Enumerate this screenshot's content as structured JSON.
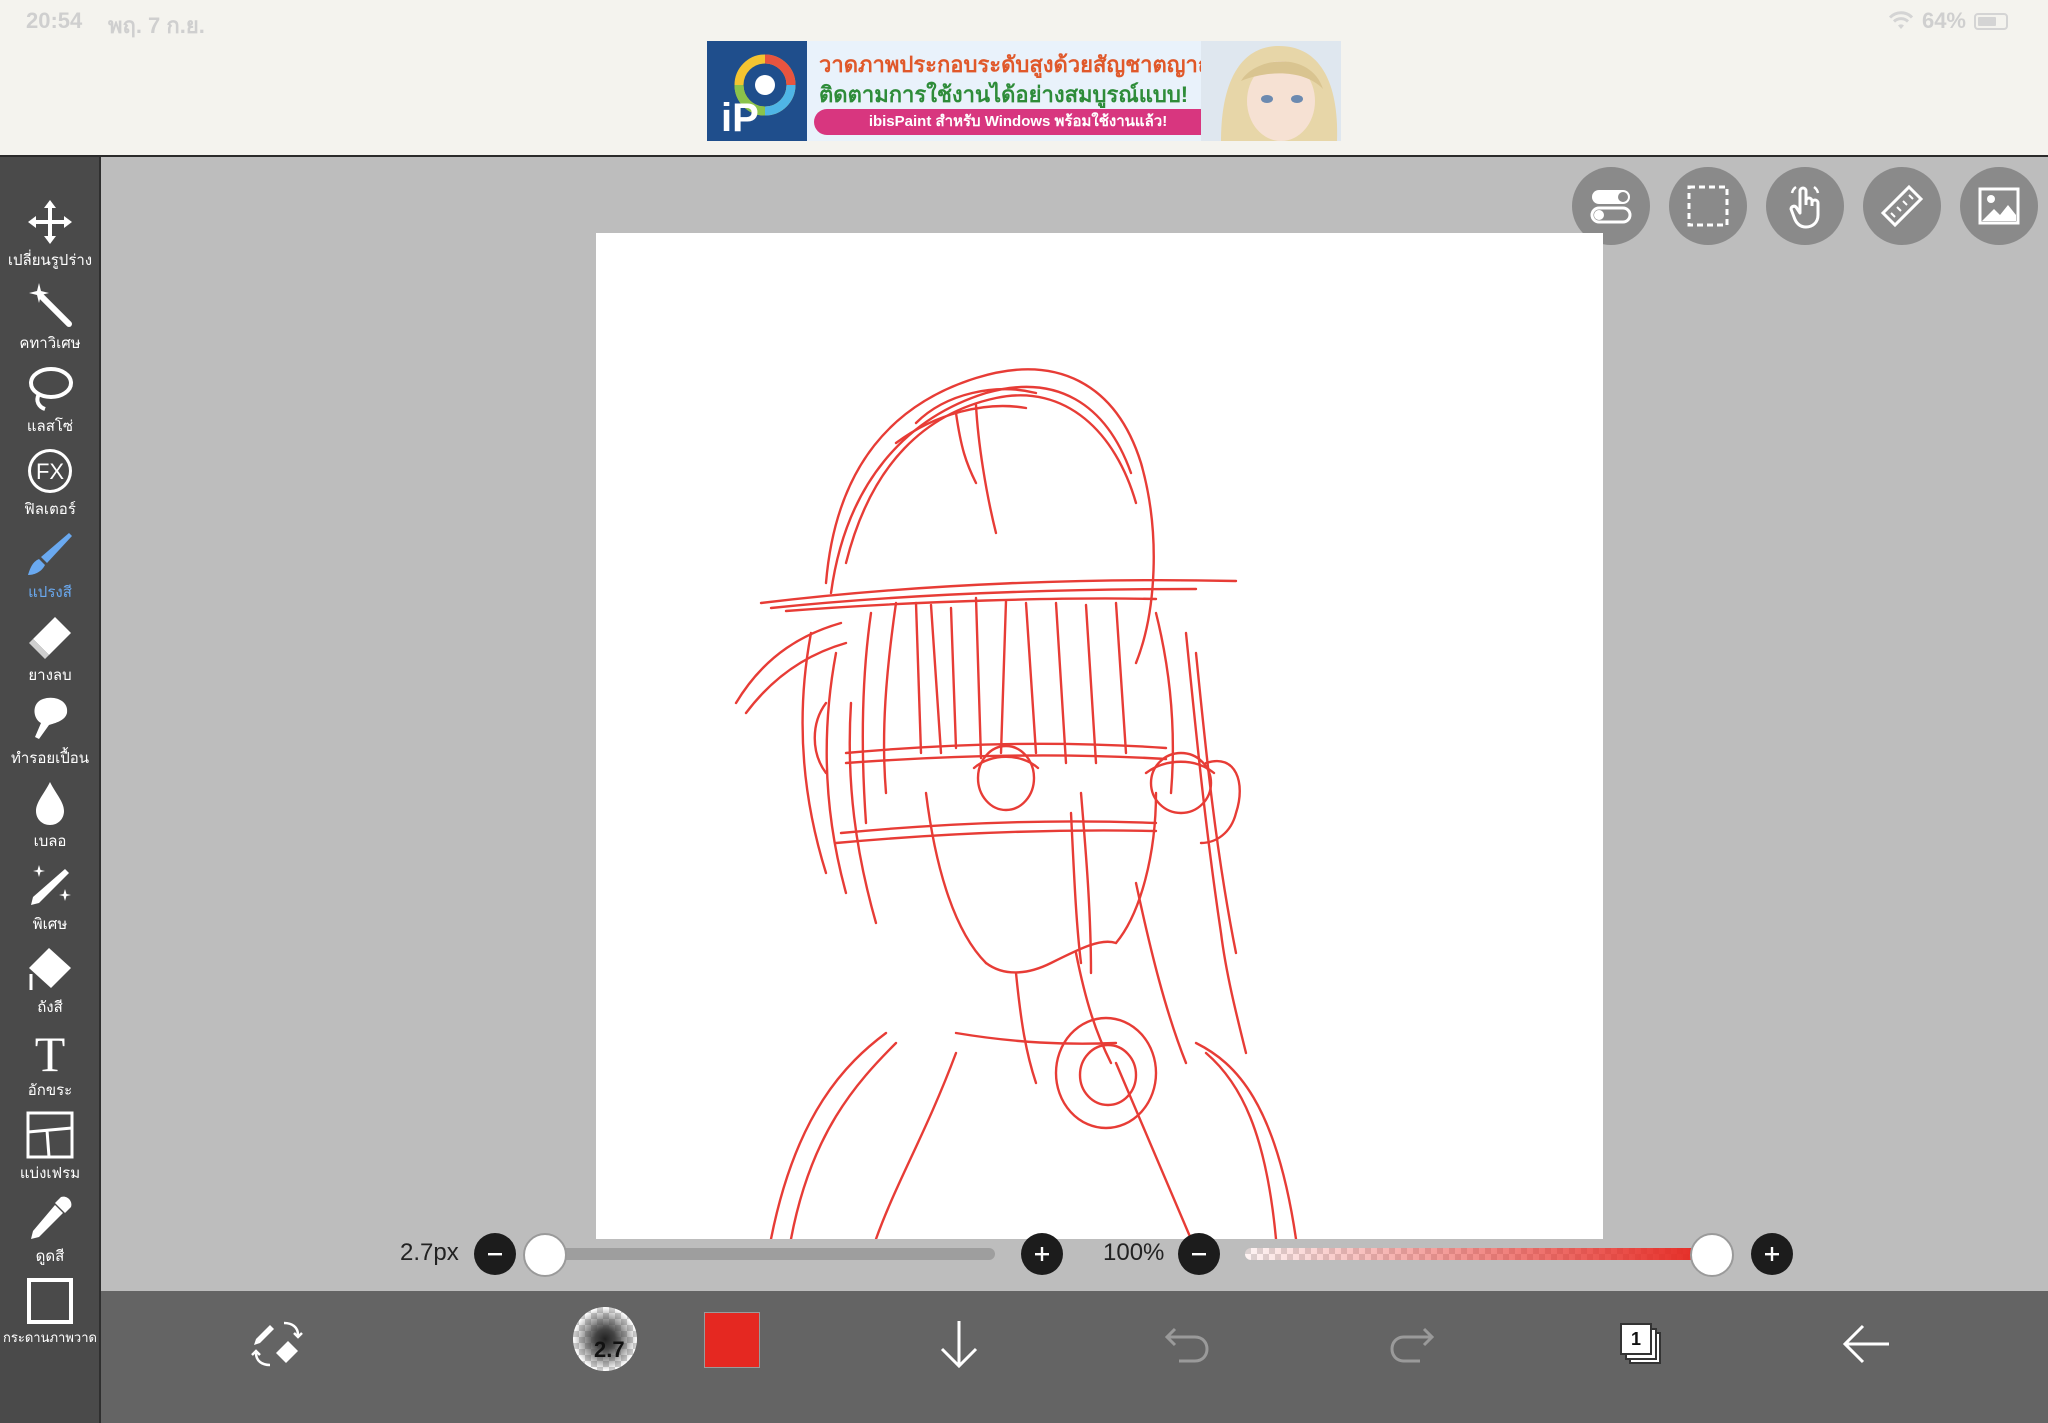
{
  "status_bar": {
    "time": "20:54",
    "date": "พฤ. 7 ก.ย.",
    "battery": "64%"
  },
  "ad_banner": {
    "line1": "วาดภาพประกอบระดับสูงด้วยสัญชาตญาณ!",
    "line2": "ติดตามการใช้งานได้อย่างสมบูรณ์แบบ!",
    "cta": "ibisPaint สำหรับ Windows พร้อมใช้งานแล้ว!",
    "logo_text": "iP"
  },
  "toolbar": {
    "items": [
      {
        "label": "เปลี่ยนรูปร่าง",
        "icon": "move-icon"
      },
      {
        "label": "คทาวิเศษ",
        "icon": "magic-wand-icon"
      },
      {
        "label": "แลสโซ่",
        "icon": "lasso-icon"
      },
      {
        "label": "ฟิลเตอร์",
        "icon": "fx-icon",
        "icon_text": "FX"
      },
      {
        "label": "แปรงสี",
        "icon": "brush-icon",
        "active": true
      },
      {
        "label": "ยางลบ",
        "icon": "eraser-icon"
      },
      {
        "label": "ทำรอยเปื้อน",
        "icon": "smudge-icon"
      },
      {
        "label": "เบลอ",
        "icon": "blur-icon"
      },
      {
        "label": "พิเศษ",
        "icon": "special-brush-icon"
      },
      {
        "label": "ถังสี",
        "icon": "bucket-icon"
      },
      {
        "label": "อักขระ",
        "icon": "text-icon",
        "icon_text": "T"
      },
      {
        "label": "แบ่งเฟรม",
        "icon": "frame-divider-icon"
      },
      {
        "label": "ดูดสี",
        "icon": "eyedropper-icon"
      },
      {
        "label": "กระดานภาพวาด",
        "icon": "canvas-icon"
      }
    ]
  },
  "top_buttons": [
    "toggle-icon",
    "selection-icon",
    "touch-icon",
    "ruler-icon",
    "image-icon"
  ],
  "sliders": {
    "brush_size_label": "2.7px",
    "brush_size_fraction": 0.0,
    "opacity_label": "100%",
    "opacity_fraction": 1.0
  },
  "bottom_bar": {
    "brush_size_text": "2.7",
    "current_color": "#e52821",
    "layer_count": "1"
  },
  "colors": {
    "toolbar_bg": "#4a4a4a",
    "bottom_bar_bg": "#646464",
    "workspace_bg": "#bdbdbd",
    "active_tool": "#6aa9f0",
    "stroke": "#e52821"
  }
}
